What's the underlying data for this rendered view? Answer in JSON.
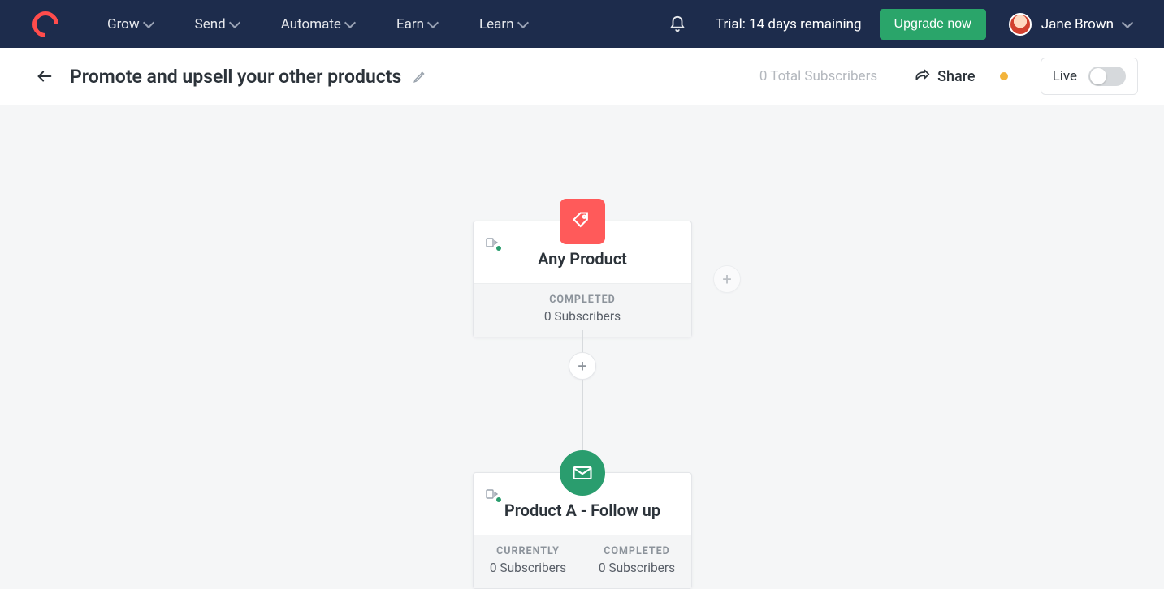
{
  "nav": {
    "items": [
      "Grow",
      "Send",
      "Automate",
      "Earn",
      "Learn"
    ],
    "trial_text": "Trial: 14 days remaining",
    "upgrade_label": "Upgrade now",
    "user_name": "Jane Brown"
  },
  "subheader": {
    "title": "Promote and upsell your other products",
    "subscriber_count_text": "0 Total Subscribers",
    "share_label": "Share",
    "live_label": "Live",
    "live_on": false
  },
  "canvas": {
    "node1": {
      "title": "Any Product",
      "completed_label": "COMPLETED",
      "completed_value": "0 Subscribers"
    },
    "node2": {
      "title": "Product A - Follow up",
      "currently_label": "CURRENTLY",
      "currently_value": "0 Subscribers",
      "completed_label": "COMPLETED",
      "completed_value": "0 Subscribers"
    }
  }
}
